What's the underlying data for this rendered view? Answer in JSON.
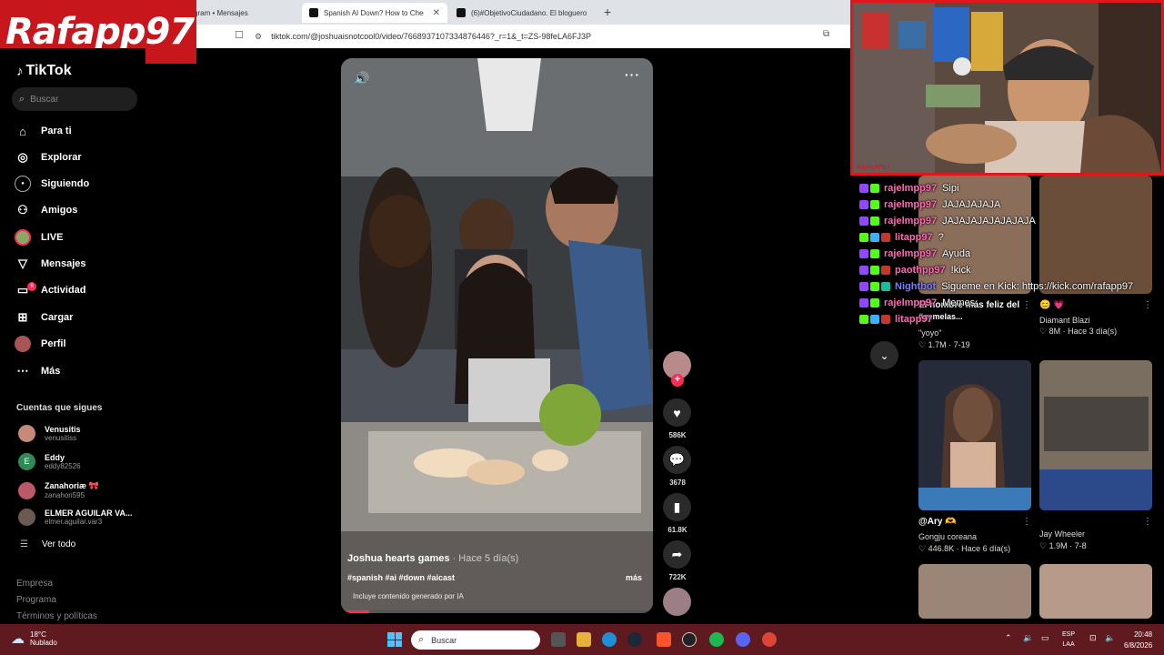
{
  "browser": {
    "tabs": [
      {
        "label": "gram • Mensajes",
        "active": false
      },
      {
        "label": "Spanish AI Down? How to Check",
        "active": true
      },
      {
        "label": "(6)#ObjetivoCiudadano. El bloguero",
        "active": false
      }
    ],
    "new_tab": "+",
    "url": "tiktok.com/@joshuaisnotcool0/video/7668937107334876446?_r=1&_t=ZS-98feLA6FJ3P"
  },
  "overlay": {
    "logo_text": "Rafapp97",
    "cam_tag": "RAFAPP97"
  },
  "sidebar": {
    "brand": "TikTok",
    "search_placeholder": "Buscar",
    "nav": [
      {
        "label": "Para ti",
        "icon": "home-icon"
      },
      {
        "label": "Explorar",
        "icon": "compass-icon"
      },
      {
        "label": "Siguiendo",
        "icon": "following-icon"
      },
      {
        "label": "Amigos",
        "icon": "friends-icon"
      },
      {
        "label": "LIVE",
        "icon": "live-icon"
      },
      {
        "label": "Mensajes",
        "icon": "send-icon"
      },
      {
        "label": "Actividad",
        "icon": "activity-icon"
      },
      {
        "label": "Cargar",
        "icon": "upload-icon"
      },
      {
        "label": "Perfil",
        "icon": "profile-icon"
      },
      {
        "label": "Más",
        "icon": "more-icon"
      }
    ],
    "activity_badge": "6",
    "following_title": "Cuentas que sigues",
    "following": [
      {
        "name": "Venusitis",
        "handle": "venusitiss",
        "color": "#c48a7a"
      },
      {
        "name": "Eddy",
        "handle": "eddy82526",
        "color": "#2e8b57",
        "initial": "E"
      },
      {
        "name": "Zanahoriæ 🎀",
        "handle": "zanahori595",
        "color": "#b85a6a"
      },
      {
        "name": "ELMER AGUILAR VA...",
        "handle": "elmer.aguilar.var3",
        "color": "#6b5a50"
      }
    ],
    "see_all": "Ver todo",
    "footer": [
      "Empresa",
      "Programa",
      "Términos y políticas"
    ]
  },
  "video": {
    "title": "Joshua hearts games",
    "ago": "· Hace 5 día(s)",
    "tags": "#spanish #ai #down #aicast",
    "more_label": "más",
    "ai_notice": "Incluye contenido generado por IA",
    "progress": 0.09
  },
  "actions": {
    "likes": "586K",
    "comments": "3678",
    "saves": "61.8K",
    "shares": "722K"
  },
  "chat": [
    {
      "user": "rajelmpp97",
      "msg": "Sipi",
      "color": "#ff69b4"
    },
    {
      "user": "rajelmpp97",
      "msg": "JAJAJAJAJA",
      "color": "#ff69b4"
    },
    {
      "user": "rajelmpp97",
      "msg": "JAJAJAJAJAJAJAJA",
      "color": "#ff69b4"
    },
    {
      "user": "litapp97",
      "msg": "?",
      "color": "#ff69b4"
    },
    {
      "user": "rajelmpp97",
      "msg": "Ayuda",
      "color": "#ff69b4"
    },
    {
      "user": "paothpp97",
      "msg": "!kick",
      "color": "#ff69b4"
    },
    {
      "user": "Nightbot",
      "msg": "Sigueme en Kick: https://kick.com/rafapp97",
      "color": "#7b7bff"
    },
    {
      "user": "rajelmpp97",
      "msg": "Memes",
      "color": "#ff69b4"
    },
    {
      "user": "litapp97",
      "msg": "",
      "color": "#ff69b4"
    }
  ],
  "grid": [
    {
      "title": "El hombre más feliz del",
      "title2": "\"yoyo\"",
      "extra": "#gemelas...",
      "stats": "♡ 1.7M · 7-19"
    },
    {
      "title": "😊 💗",
      "sub": "Diamant Blazi",
      "stats": "♡ 8M · Hace 3 día(s)"
    },
    {
      "title": "@Ary 🫶",
      "sub": "Gongju coreana",
      "stats": "♡ 446.8K · Hace 6 día(s)"
    },
    {
      "title": "",
      "sub": "Jay Wheeler",
      "stats": "♡ 1.9M · 7-8"
    }
  ],
  "taskbar": {
    "temp": "18°C",
    "weather": "Nublado",
    "search": "Buscar",
    "lang1": "ESP",
    "lang2": "LAA",
    "time": "20:48",
    "date": "6/8/2026"
  }
}
